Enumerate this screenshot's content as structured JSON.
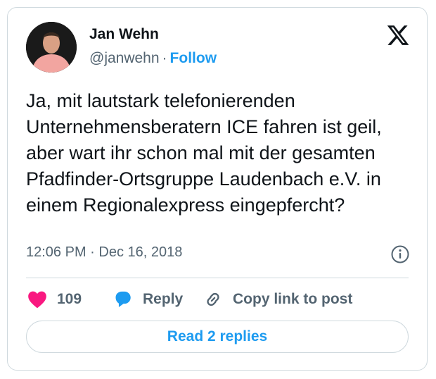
{
  "author": {
    "name": "Jan Wehn",
    "handle": "@janwehn",
    "separator": "·",
    "follow_label": "Follow"
  },
  "tweet": {
    "text": "Ja, mit lautstark telefonierenden Unternehmensberatern ICE fahren ist geil, aber wart ihr schon mal mit der gesamten Pfadfinder-Ortsgruppe Laudenbach e.V. in einem Regionalexpress eingepfercht?",
    "timestamp": "12:06 PM · Dec 16, 2018"
  },
  "actions": {
    "like_count": "109",
    "reply_label": "Reply",
    "copy_label": "Copy link to post"
  },
  "read_replies_label": "Read 2 replies",
  "icons": {
    "brand": "x-logo-icon",
    "info": "info-icon",
    "like": "heart-icon",
    "reply": "speech-bubble-icon",
    "copy": "link-icon"
  },
  "colors": {
    "accent": "#1d9bf0",
    "like": "#f91880",
    "text": "#0f1419",
    "muted": "#536471",
    "border": "#cfd9de"
  }
}
